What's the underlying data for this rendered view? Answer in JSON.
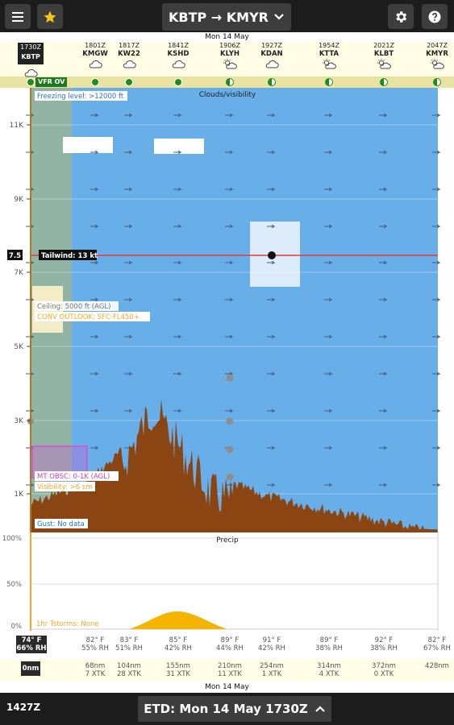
{
  "header": {
    "route": "KBTP → KMYR",
    "menu_icon": "hamburger-menu-icon",
    "favorite_icon": "star-icon",
    "settings_icon": "gear-icon",
    "help_icon": "help-icon",
    "accent_star": "#f5c518"
  },
  "date_top": "Mon 14 May",
  "date_bottom": "Mon 14 May",
  "waypoints": [
    {
      "time": "1730Z",
      "id": "KBTP",
      "wx": "overcast",
      "cond": "vfr-ov",
      "selected": true
    },
    {
      "time": "1801Z",
      "id": "KMGW",
      "wx": "cloudy",
      "cond": "vfr"
    },
    {
      "time": "1817Z",
      "id": "KW22",
      "wx": "cloudy",
      "cond": "vfr"
    },
    {
      "time": "1841Z",
      "id": "KSHD",
      "wx": "cloudy",
      "cond": "vfr"
    },
    {
      "time": "1906Z",
      "id": "KLYH",
      "wx": "sun-cloud",
      "cond": "vfr"
    },
    {
      "time": "1927Z",
      "id": "KDAN",
      "wx": "cloudy",
      "cond": "vfr"
    },
    {
      "time": "1954Z",
      "id": "KTTA",
      "wx": "sun-cloud",
      "cond": "vfr"
    },
    {
      "time": "2021Z",
      "id": "KLBT",
      "wx": "sun-cloud",
      "cond": "vfr"
    },
    {
      "time": "2047Z",
      "id": "KMYR",
      "wx": "sun-cloud",
      "cond": "vfr"
    }
  ],
  "condition_badge": "VFR OV",
  "profile": {
    "title": "Clouds/visibility",
    "freezing_level": "Freezing level: >12000 ft",
    "y_ticks": [
      "11K",
      "9K",
      "7K",
      "5K",
      "3K",
      "1K"
    ],
    "altitude_marker": "7.5",
    "tailwind": "Tailwind: 13 kt",
    "ceiling": "Ceiling: 5000 ft (AGL)",
    "conv_outlook": "CONV OUTLOOK: SFC-FL450+",
    "mt_obsc": "MT OBSC: 0-1K (AGL)",
    "visibility": "Visibility: >6 sm",
    "gust": "Gust: No data",
    "colors": {
      "sky": "#68aee8",
      "terrain": "#8a4512",
      "route_line": "#e23b3b",
      "outlook": "#f5a623",
      "obsc": "#d64fd6"
    }
  },
  "precip": {
    "title": "Precip",
    "y_ticks": [
      "100%",
      "50%",
      "0%"
    ],
    "tstorms": "1hr Tstorms: None",
    "color": "#f5b400"
  },
  "temps": [
    {
      "t": "74° F",
      "rh": "66% RH",
      "selected": true
    },
    {
      "t": "82° F",
      "rh": "55% RH"
    },
    {
      "t": "83° F",
      "rh": "51% RH"
    },
    {
      "t": "85° F",
      "rh": "42% RH"
    },
    {
      "t": "89° F",
      "rh": "44% RH"
    },
    {
      "t": "91° F",
      "rh": "42% RH"
    },
    {
      "t": "89° F",
      "rh": "38% RH"
    },
    {
      "t": "92° F",
      "rh": "38% RH"
    },
    {
      "t": "82° F",
      "rh": "67% RH"
    }
  ],
  "distances": [
    {
      "d": "0nm",
      "x": "",
      "selected": true
    },
    {
      "d": "68nm",
      "x": "7 XTK"
    },
    {
      "d": "104nm",
      "x": "28 XTK"
    },
    {
      "d": "155nm",
      "x": "31 XTK"
    },
    {
      "d": "210nm",
      "x": "11 XTK"
    },
    {
      "d": "254nm",
      "x": "1 XTK"
    },
    {
      "d": "314nm",
      "x": "4 XTK"
    },
    {
      "d": "372nm",
      "x": "0 XTK"
    },
    {
      "d": "428nm",
      "x": ""
    }
  ],
  "footer": {
    "utc_time": "1427Z",
    "etd": "ETD: Mon 14 May 1730Z"
  }
}
